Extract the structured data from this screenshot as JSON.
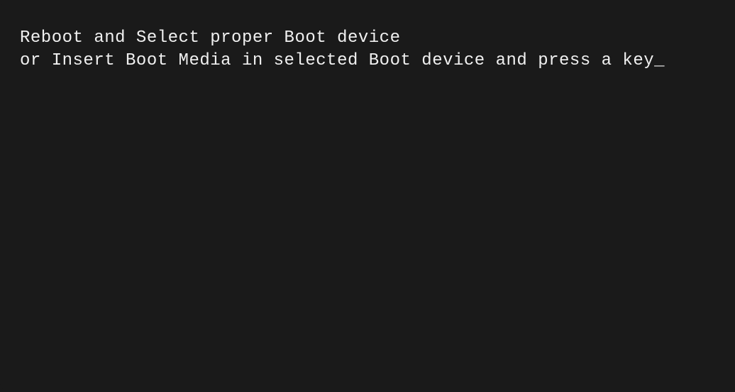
{
  "bios": {
    "line1": "Reboot and Select proper Boot device",
    "line2": "or Insert Boot Media in selected Boot device and press a key",
    "cursor": "_"
  }
}
